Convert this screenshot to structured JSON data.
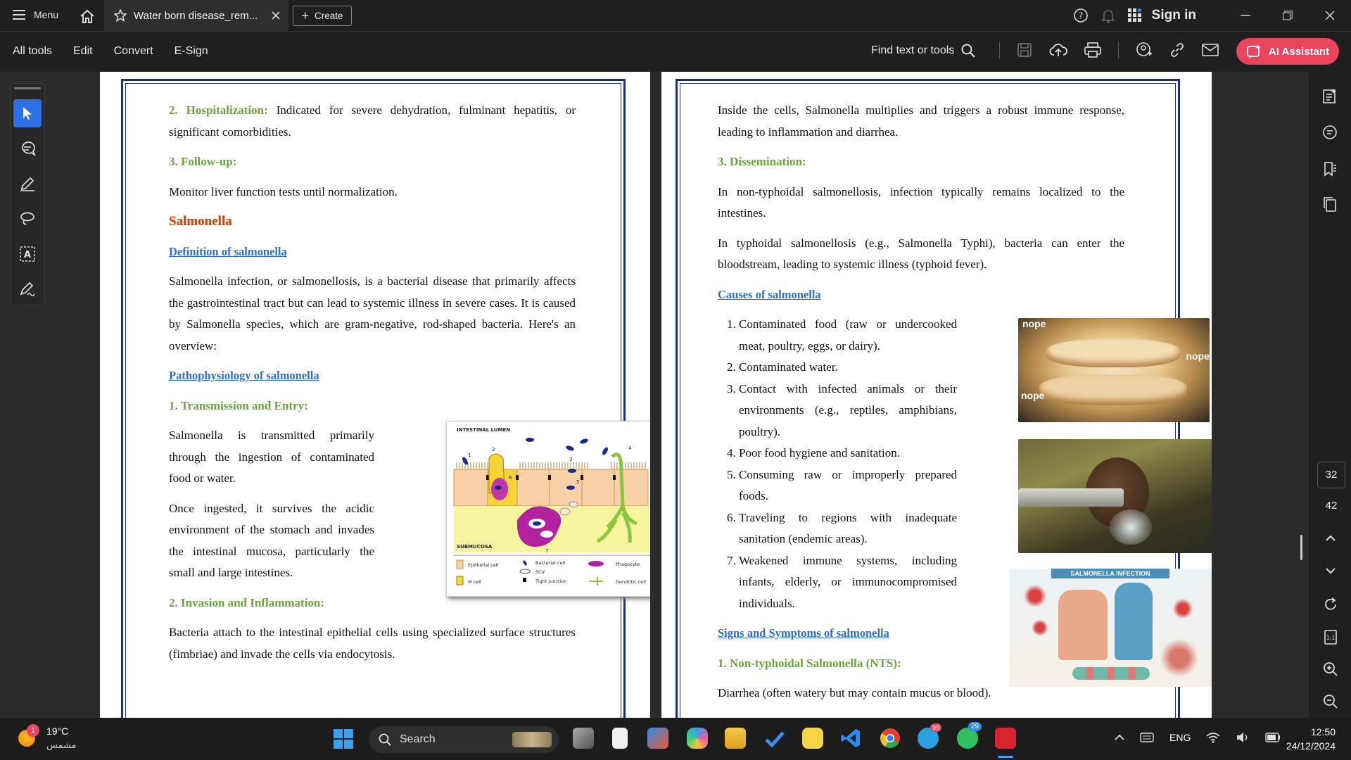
{
  "titlebar": {
    "menu_label": "Menu",
    "tab_title": "Water born disease_rem...",
    "create_label": "Create",
    "sign_in": "Sign in"
  },
  "toolbar": {
    "menus": [
      "All tools",
      "Edit",
      "Convert",
      "E-Sign"
    ],
    "find_label": "Find text or tools",
    "ai_label": "AI Assistant"
  },
  "pages": {
    "current": "32",
    "total": "42"
  },
  "page1": {
    "hosp_head": "2. Hospitalization:",
    "hosp_text": " Indicated for severe dehydration, fulminant hepatitis, or significant comorbidities.",
    "follow_head": "3. Follow-up:",
    "follow_text": "Monitor liver function tests until normalization.",
    "salmonella": "Salmonella",
    "definition_head": "Definition of salmonella",
    "definition_text": "Salmonella infection, or salmonellosis, is a bacterial disease that primarily affects the gastrointestinal tract but can lead to systemic illness in severe cases. It is caused by Salmonella species, which are gram-negative, rod-shaped bacteria. Here's an overview:",
    "patho_head": "Pathophysiology of salmonella",
    "trans_head": "1. Transmission and Entry:",
    "trans_text": "Salmonella is transmitted primarily through the ingestion of contaminated food or water.",
    "ingest_text": "Once ingested, it survives the acidic environment of the stomach and invades the intestinal mucosa, particularly the small and large intestines.",
    "invasion_head": "2. Invasion and Inflammation:",
    "invasion_text": "Bacteria attach to the intestinal epithelial cells using specialized surface structures (fimbriae) and invade the cells via endocytosis.",
    "figure": {
      "lumen": "INTESTINAL LUMEN",
      "submucosa": "SUBMUCOSA",
      "legend": [
        "Epithelial cell",
        "Bacterial cell",
        "Phagocyte",
        "SCV",
        "M cell",
        "Tight junction",
        "Dendritic cell"
      ],
      "nums": [
        "1",
        "2",
        "3",
        "4",
        "5",
        "6",
        "7"
      ]
    }
  },
  "page2": {
    "inside_text": "Inside the cells, Salmonella multiplies and triggers a robust immune response, leading to inflammation and diarrhea.",
    "dissem_head": "3. Dissemination:",
    "nontyph_text": "In non-typhoidal salmonellosis, infection typically remains localized to the intestines.",
    "typh_text": "In typhoidal salmonellosis (e.g., Salmonella Typhi), bacteria can enter the bloodstream, leading to systemic illness (typhoid fever).",
    "causes_head": "Causes of salmonella",
    "causes": [
      "Contaminated food (raw or undercooked meat, poultry, eggs, or dairy).",
      "Contaminated water.",
      "Contact with infected animals or their environments (e.g., reptiles, amphibians, poultry).",
      "Poor food hygiene and sanitation.",
      "Consuming raw or improperly prepared foods.",
      "Traveling to regions with inadequate sanitation (endemic areas).",
      "Weakened immune systems, including infants, elderly, or immunocompromised individuals."
    ],
    "signs_head": "Signs and Symptoms of salmonella",
    "nts_head": "1. Non-typhoidal Salmonella (NTS):",
    "diarrhea_text": "Diarrhea (often watery but may contain mucus or blood).",
    "img1_labels": [
      "nope",
      "nope",
      "nope"
    ],
    "infographic_title": "SALMONELLA INFECTION"
  },
  "taskbar": {
    "temp": "19°C",
    "weather": "مشمس",
    "weather_badge": "1",
    "search": "Search",
    "lang": "ENG",
    "time": "12:50",
    "date": "24/12/2024",
    "telegram_badge": "99",
    "whatsapp_badge": "29"
  },
  "colors": {
    "accent": "#2f6fe4",
    "ai_button": "#e9455c",
    "green_heading": "#6aa43a",
    "blue_heading": "#2d6fd0",
    "frame": "#1f2f6e"
  }
}
